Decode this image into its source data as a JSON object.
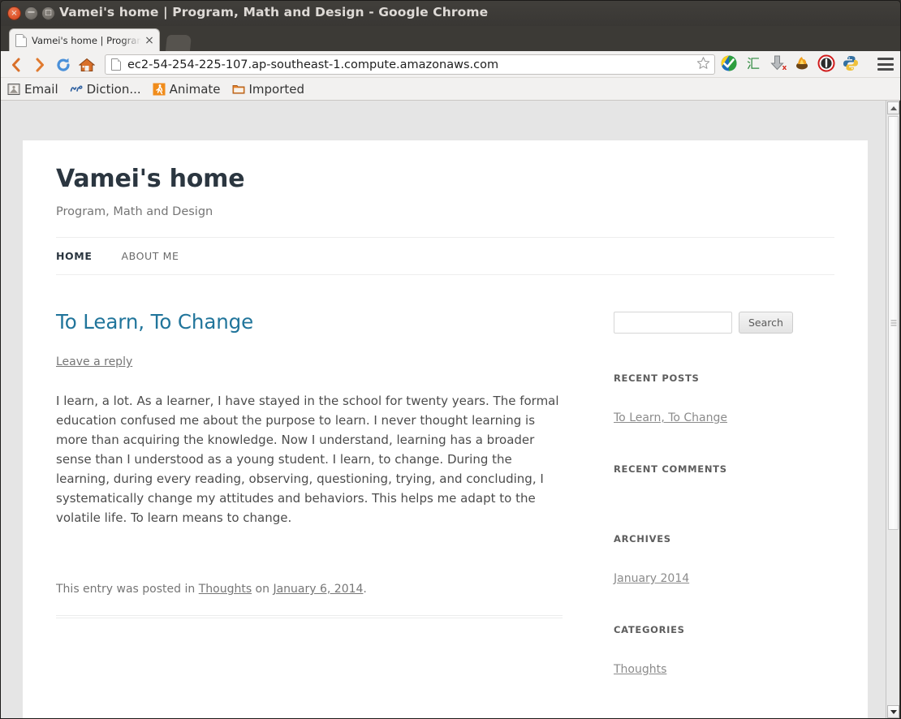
{
  "window": {
    "title": "Vamei's home | Program, Math and Design - Google Chrome",
    "close_glyph": "×",
    "minimize_glyph": "−",
    "maximize_glyph": "□"
  },
  "tabs": [
    {
      "title": "Vamei's home | Program, Math and Design",
      "close_label": "×"
    }
  ],
  "toolbar": {
    "back_label": "‹",
    "forward_label": "›",
    "reload_label": "↻",
    "home_label": "home-icon",
    "url": "ec2-54-254-225-107.ap-southeast-1.compute.amazonaws.com",
    "star_label": "☆",
    "menu_label": "≡",
    "extensions": [
      {
        "name": "checkmark-shield-icon"
      },
      {
        "name": "chinese-character-icon"
      },
      {
        "name": "download-icon"
      },
      {
        "name": "flame-icon"
      },
      {
        "name": "adblock-stop-icon"
      },
      {
        "name": "python-icon"
      }
    ]
  },
  "bookmarks": [
    {
      "label": "Email",
      "icon": "mail-icon"
    },
    {
      "label": "Diction...",
      "icon": "dictionary-icon"
    },
    {
      "label": "Animate",
      "icon": "running-person-icon"
    },
    {
      "label": "Imported",
      "icon": "folder-icon"
    }
  ],
  "site": {
    "title": "Vamei's home",
    "description": "Program, Math and Design",
    "nav": [
      {
        "label": "Home",
        "current": true
      },
      {
        "label": "About Me",
        "current": false
      }
    ]
  },
  "post": {
    "title": "To Learn, To Change",
    "reply_link": "Leave a reply",
    "body": "I learn, a lot. As a learner, I have stayed in the school for twenty years. The formal education confused me about the purpose to learn. I never thought learning is more than acquiring the knowledge. Now I understand, learning has a broader sense than I understood as a young student. I learn, to change. During the learning, during every reading, observing, questioning, trying, and concluding, I systematically change my attitudes and behaviors. This helps me adapt to the volatile life. To learn means to change.",
    "meta_prefix": "This entry was posted in ",
    "meta_category": "Thoughts",
    "meta_middle": " on ",
    "meta_date": "January 6, 2014",
    "meta_suffix": "."
  },
  "sidebar": {
    "search": {
      "value": "",
      "placeholder": "",
      "button_label": "Search"
    },
    "widgets": [
      {
        "title": "Recent Posts",
        "items": [
          {
            "label": "To Learn, To Change"
          }
        ]
      },
      {
        "title": "Recent Comments",
        "items": []
      },
      {
        "title": "Archives",
        "items": [
          {
            "label": "January 2014"
          }
        ]
      },
      {
        "title": "Categories",
        "items": [
          {
            "label": "Thoughts"
          }
        ]
      }
    ]
  },
  "colors": {
    "link": "#21759b",
    "heading": "#2b3640",
    "body_text": "#4c4c4c",
    "muted": "#767676",
    "page_bg": "#e5e5e5",
    "chrome_bg": "#f2f1f0",
    "titlebar_bg": "#3c3b37"
  },
  "scrollbar": {
    "up_arrow": "▲",
    "down_arrow": "▼"
  }
}
